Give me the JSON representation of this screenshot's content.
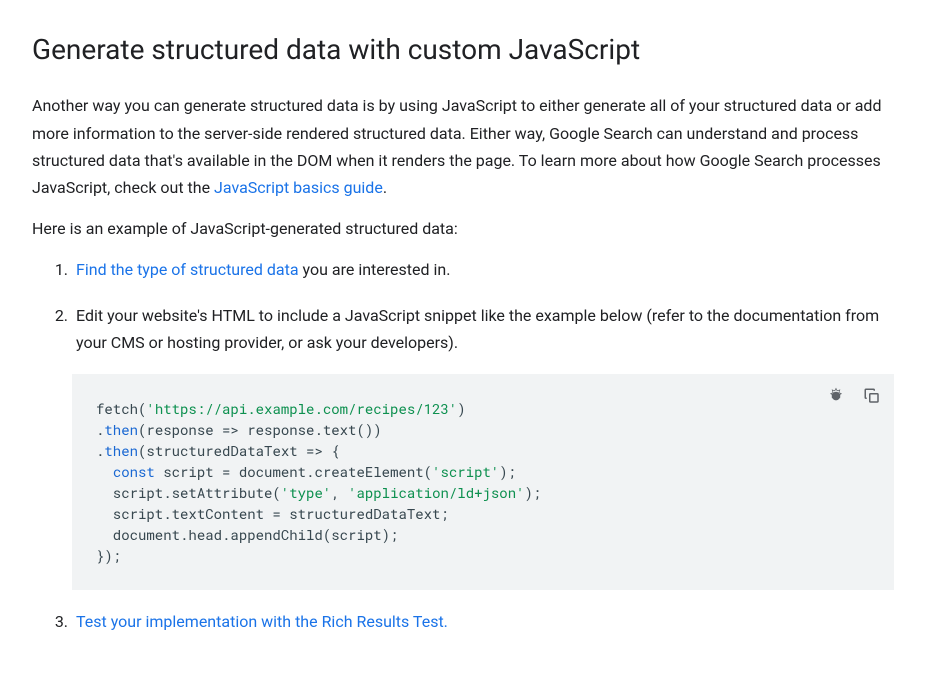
{
  "heading": "Generate structured data with custom JavaScript",
  "intro": {
    "part1": "Another way you can generate structured data is by using JavaScript to either generate all of your structured data or add more information to the server-side rendered structured data. Either way, Google Search can understand and process structured data that's available in the DOM when it renders the page. To learn more about how Google Search processes JavaScript, check out the ",
    "link_text": "JavaScript basics guide",
    "part2": "."
  },
  "example_lead": "Here is an example of JavaScript-generated structured data:",
  "steps": {
    "s1": {
      "link": "Find the type of structured data",
      "suffix": " you are interested in."
    },
    "s2": {
      "text": "Edit your website's HTML to include a JavaScript snippet like the example below (refer to the documentation from your CMS or hosting provider, or ask your developers)."
    },
    "s3": {
      "link": "Test your implementation with the Rich Results Test."
    }
  },
  "code": {
    "l1_fetch": "fetch",
    "l1_paren": "(",
    "l1_url": "'https://api.example.com/recipes/123'",
    "l1_close": ")",
    "l2_dot": ".",
    "l2_then": "then",
    "l2_body": "(response => response.text())",
    "l3_dot": ".",
    "l3_then": "then",
    "l3_body": "(structuredDataText => {",
    "l4_indent": "  ",
    "l4_const": "const",
    "l4_rest": " script = document.createElement(",
    "l4_str": "'script'",
    "l4_close": ");",
    "l5_indent": "  script.setAttribute(",
    "l5_str1": "'type'",
    "l5_comma": ", ",
    "l5_str2": "'application/ld+json'",
    "l5_close": ");",
    "l6": "  script.textContent = structuredDataText;",
    "l7": "  document.head.appendChild(script);",
    "l8": "});"
  }
}
